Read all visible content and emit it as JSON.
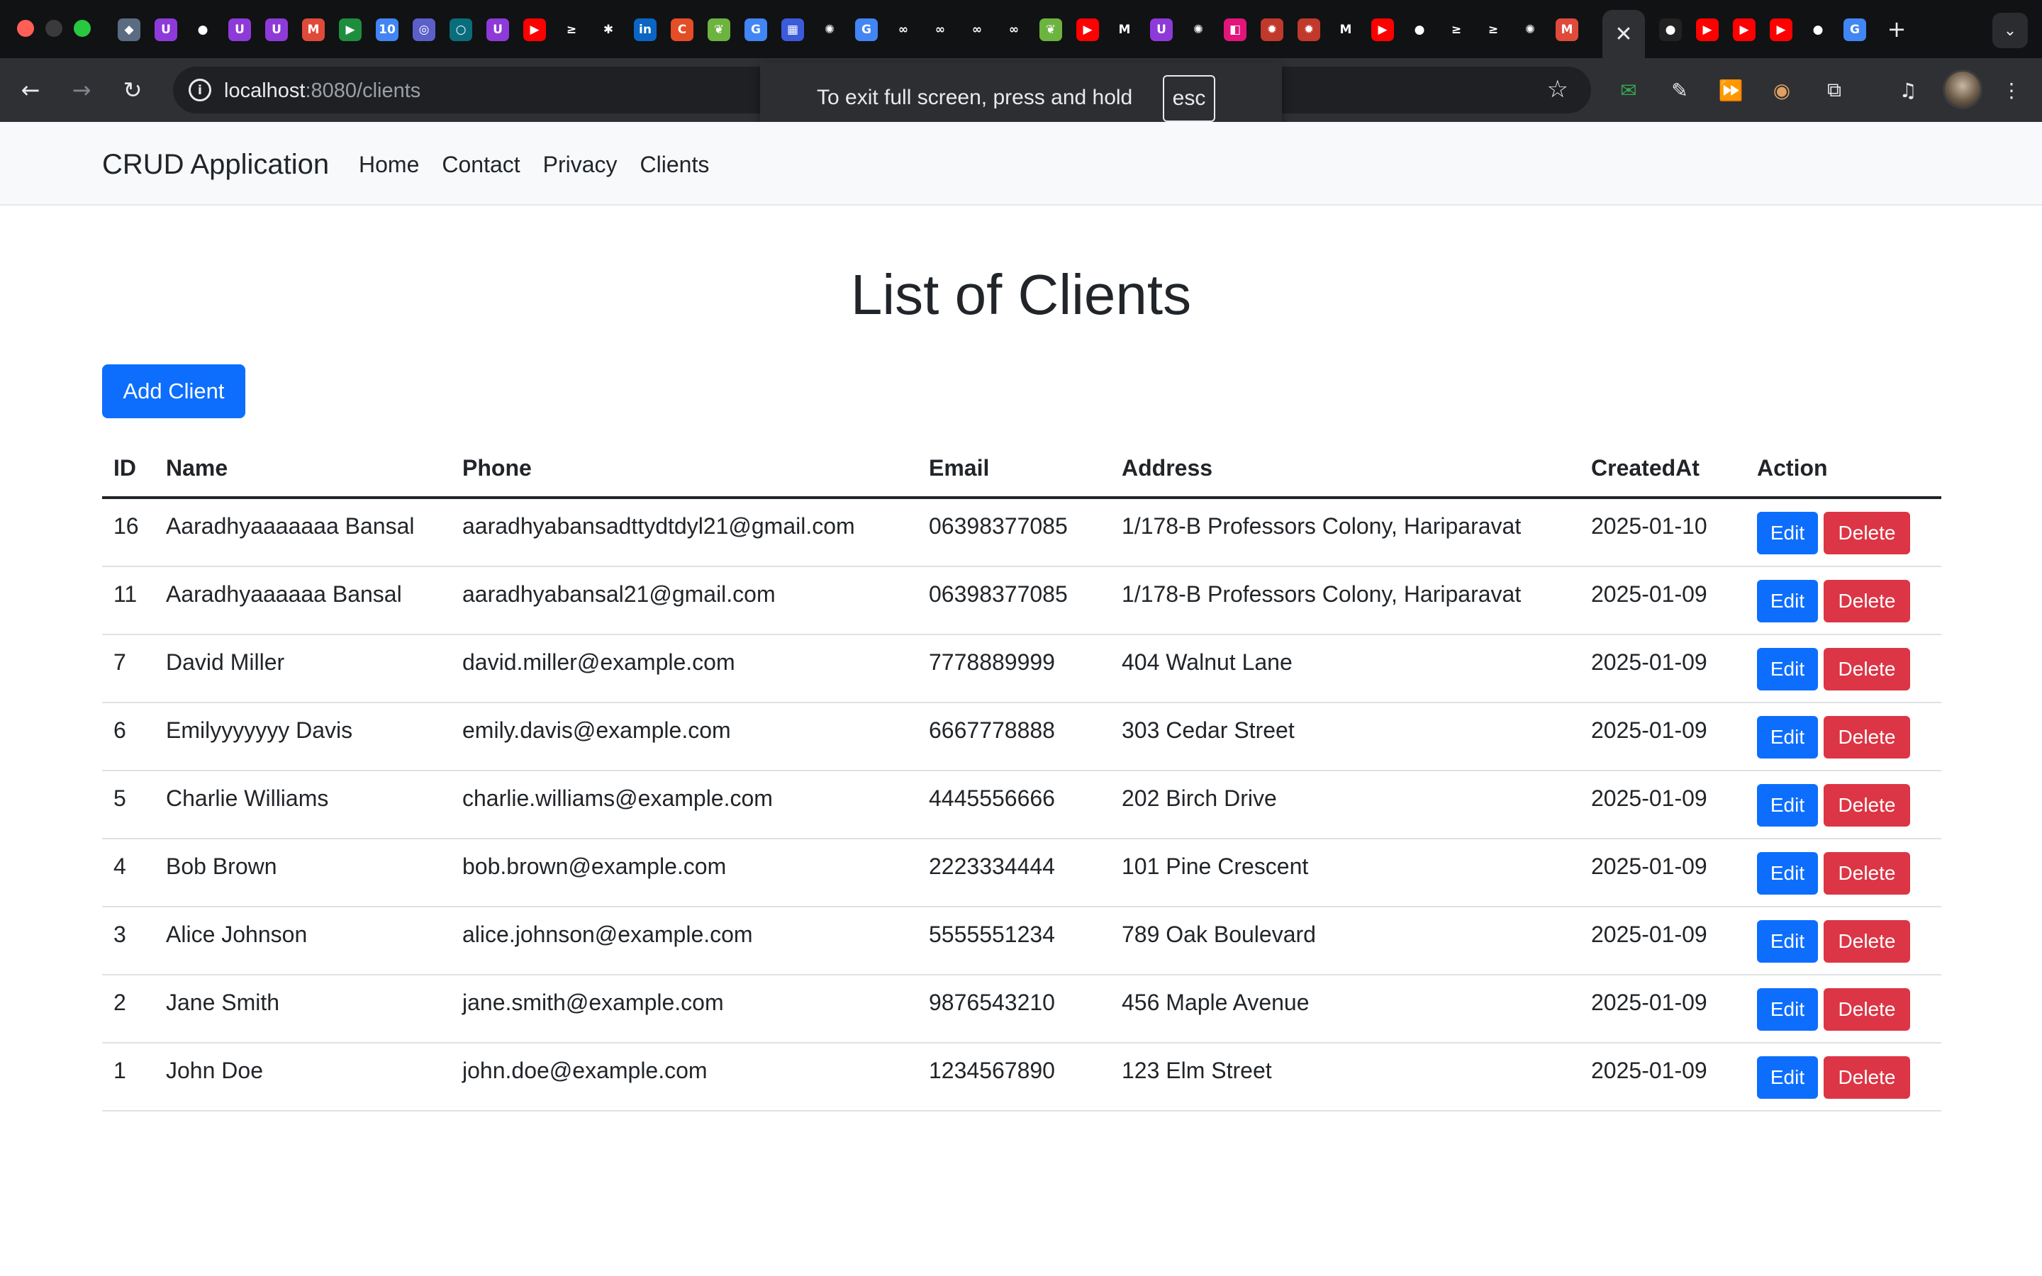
{
  "browser": {
    "url_host": "localhost",
    "url_path": ":8080/clients",
    "fullscreen_message": "To exit full screen, press and hold",
    "fullscreen_key": "esc",
    "active_tab_close": "✕",
    "new_tab": "+",
    "tab_favicons": [
      {
        "icon": "nordpass-icon",
        "glyph": "◆",
        "color": "#5a6b82"
      },
      {
        "icon": "udemy-icon",
        "glyph": "U",
        "color": "#8e3ad9"
      },
      {
        "icon": "github-icon",
        "glyph": "●",
        "color": "#111214"
      },
      {
        "icon": "udemy-icon",
        "glyph": "U",
        "color": "#8e3ad9"
      },
      {
        "icon": "udemy-icon",
        "glyph": "U",
        "color": "#8e3ad9"
      },
      {
        "icon": "gmail-icon",
        "glyph": "M",
        "color": "#e04a3b"
      },
      {
        "icon": "meet-icon",
        "glyph": "▶",
        "color": "#1e8e3e"
      },
      {
        "icon": "calendar-icon",
        "glyph": "10",
        "color": "#4285f4"
      },
      {
        "icon": "app-icon",
        "glyph": "◎",
        "color": "#5b5fc7"
      },
      {
        "icon": "loader-icon",
        "glyph": "○",
        "color": "#0a6d7c"
      },
      {
        "icon": "udemy-icon",
        "glyph": "U",
        "color": "#8e3ad9"
      },
      {
        "icon": "youtube-icon",
        "glyph": "▶",
        "color": "#ff0000"
      },
      {
        "icon": "bolt-icon",
        "glyph": "≥",
        "color": "#111214"
      },
      {
        "icon": "perplexity-icon",
        "glyph": "✱",
        "color": "#111214"
      },
      {
        "icon": "linkedin-icon",
        "glyph": "in",
        "color": "#0a66c2"
      },
      {
        "icon": "app-icon",
        "glyph": "C",
        "color": "#e44d26"
      },
      {
        "icon": "spring-icon",
        "glyph": "❦",
        "color": "#6db33f"
      },
      {
        "icon": "google-icon",
        "glyph": "G",
        "color": "#4285f4"
      },
      {
        "icon": "app-icon",
        "glyph": "▦",
        "color": "#3b5bdb"
      },
      {
        "icon": "openai-icon",
        "glyph": "✺",
        "color": "#111214"
      },
      {
        "icon": "google-icon",
        "glyph": "G",
        "color": "#4285f4"
      },
      {
        "icon": "geeksforgeeks-icon",
        "glyph": "∞",
        "color": "#111214"
      },
      {
        "icon": "geeksforgeeks-icon",
        "glyph": "∞",
        "color": "#111214"
      },
      {
        "icon": "geeksforgeeks-icon",
        "glyph": "∞",
        "color": "#111214"
      },
      {
        "icon": "geeksforgeeks-icon",
        "glyph": "∞",
        "color": "#111214"
      },
      {
        "icon": "spring-icon",
        "glyph": "❦",
        "color": "#6db33f"
      },
      {
        "icon": "youtube-icon",
        "glyph": "▶",
        "color": "#ff0000"
      },
      {
        "icon": "medium-icon",
        "glyph": "M",
        "color": "#111214"
      },
      {
        "icon": "udemy-icon",
        "glyph": "U",
        "color": "#8e3ad9"
      },
      {
        "icon": "openai-icon",
        "glyph": "✺",
        "color": "#111214"
      },
      {
        "icon": "app-icon",
        "glyph": "◧",
        "color": "#e3157a"
      },
      {
        "icon": "bug-icon",
        "glyph": "✹",
        "color": "#c0392b"
      },
      {
        "icon": "bug-icon",
        "glyph": "✹",
        "color": "#c0392b"
      },
      {
        "icon": "medium-icon",
        "glyph": "M",
        "color": "#111214"
      },
      {
        "icon": "youtube-icon",
        "glyph": "▶",
        "color": "#ff0000"
      },
      {
        "icon": "github-icon",
        "glyph": "●",
        "color": "#111214"
      },
      {
        "icon": "bolt-icon",
        "glyph": "≥",
        "color": "#111214"
      },
      {
        "icon": "bolt-icon",
        "glyph": "≥",
        "color": "#111214"
      },
      {
        "icon": "openai-icon",
        "glyph": "✺",
        "color": "#111214"
      },
      {
        "icon": "gmail-icon",
        "glyph": "M",
        "color": "#e04a3b"
      }
    ],
    "right_favicons": [
      {
        "icon": "github-icon",
        "glyph": "●",
        "color": "#222"
      },
      {
        "icon": "youtube-icon",
        "glyph": "▶",
        "color": "#ff0000"
      },
      {
        "icon": "youtube-icon",
        "glyph": "▶",
        "color": "#ff0000"
      },
      {
        "icon": "youtube-icon",
        "glyph": "▶",
        "color": "#ff0000"
      },
      {
        "icon": "github-icon",
        "glyph": "●",
        "color": "#111214"
      },
      {
        "icon": "google-icon",
        "glyph": "G",
        "color": "#4285f4"
      }
    ]
  },
  "app": {
    "brand": "CRUD Application",
    "nav": [
      "Home",
      "Contact",
      "Privacy",
      "Clients"
    ]
  },
  "page": {
    "title": "List of Clients",
    "add_button": "Add Client"
  },
  "table": {
    "headers": [
      "ID",
      "Name",
      "Phone",
      "Email",
      "Address",
      "CreatedAt",
      "Action"
    ],
    "edit_label": "Edit",
    "delete_label": "Delete",
    "rows": [
      {
        "id": "16",
        "name": "Aaradhyaaaaaaa Bansal",
        "phone": "aaradhyabansadttydtdyl21@gmail.com",
        "email": "06398377085",
        "address": "1/178-B Professors Colony, Hariparavat",
        "created": "2025-01-10"
      },
      {
        "id": "11",
        "name": "Aaradhyaaaaaa Bansal",
        "phone": "aaradhyabansal21@gmail.com",
        "email": "06398377085",
        "address": "1/178-B Professors Colony, Hariparavat",
        "created": "2025-01-09"
      },
      {
        "id": "7",
        "name": "David Miller",
        "phone": "david.miller@example.com",
        "email": "7778889999",
        "address": "404 Walnut Lane",
        "created": "2025-01-09"
      },
      {
        "id": "6",
        "name": "Emilyyyyyyy Davis",
        "phone": "emily.davis@example.com",
        "email": "6667778888",
        "address": "303 Cedar Street",
        "created": "2025-01-09"
      },
      {
        "id": "5",
        "name": "Charlie Williams",
        "phone": "charlie.williams@example.com",
        "email": "4445556666",
        "address": "202 Birch Drive",
        "created": "2025-01-09"
      },
      {
        "id": "4",
        "name": "Bob Brown",
        "phone": "bob.brown@example.com",
        "email": "2223334444",
        "address": "101 Pine Crescent",
        "created": "2025-01-09"
      },
      {
        "id": "3",
        "name": "Alice Johnson",
        "phone": "alice.johnson@example.com",
        "email": "5555551234",
        "address": "789 Oak Boulevard",
        "created": "2025-01-09"
      },
      {
        "id": "2",
        "name": "Jane Smith",
        "phone": "jane.smith@example.com",
        "email": "9876543210",
        "address": "456 Maple Avenue",
        "created": "2025-01-09"
      },
      {
        "id": "1",
        "name": "John Doe",
        "phone": "john.doe@example.com",
        "email": "1234567890",
        "address": "123 Elm Street",
        "created": "2025-01-09"
      }
    ]
  },
  "colors": {
    "primary": "#0d6efd",
    "danger": "#dc3545",
    "navbar_bg": "#f8f9fa",
    "chrome_bg": "#111214",
    "toolbar_bg": "#2f3033"
  }
}
